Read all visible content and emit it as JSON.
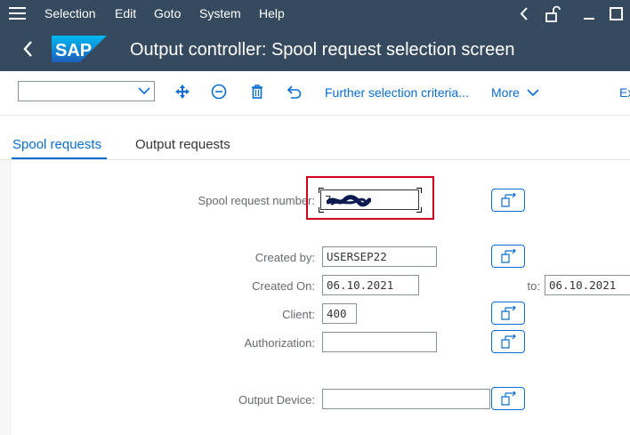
{
  "menubar": {
    "items": [
      {
        "label": "Selection"
      },
      {
        "label": "Edit"
      },
      {
        "label": "Goto"
      },
      {
        "label": "System"
      },
      {
        "label": "Help"
      }
    ]
  },
  "titlebar": {
    "logo_text": "SAP",
    "title": "Output controller: Spool request selection screen"
  },
  "toolbar": {
    "variant_value": "",
    "further_selection_label": "Further selection criteria...",
    "more_label": "More",
    "exit_label": "Exit"
  },
  "tabs": [
    {
      "label": "Spool requests",
      "active": true
    },
    {
      "label": "Output requests",
      "active": false
    }
  ],
  "form": {
    "spool_request_number": {
      "label": "Spool request number:",
      "value": "7"
    },
    "created_by": {
      "label": "Created by:",
      "value": "USERSEP22"
    },
    "created_on": {
      "label": "Created On:",
      "value": "06.10.2021",
      "to_label": "to:",
      "to_value": "06.10.2021"
    },
    "client": {
      "label": "Client:",
      "value": "400"
    },
    "authorization": {
      "label": "Authorization:",
      "value": ""
    },
    "output_device": {
      "label": "Output Device:",
      "value": ""
    }
  },
  "colors": {
    "shell": "#354a5f",
    "accent": "#0a6ed1",
    "highlight_box": "#d0021b"
  }
}
